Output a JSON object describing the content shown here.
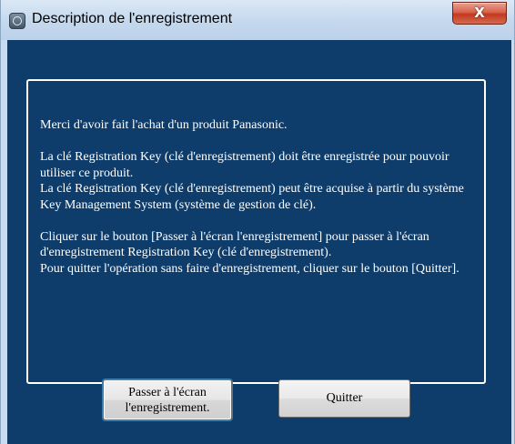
{
  "window": {
    "title": "Description de l'enregistrement",
    "app_icon": "panasonic-app-icon",
    "close_symbol": "X"
  },
  "message": {
    "paragraphs": [
      "Merci d'avoir fait l'achat d'un produit Panasonic.",
      "La clé Registration Key (clé d'enregistrement) doit être enregistrée pour pouvoir utiliser ce produit.",
      "La clé Registration Key (clé d'enregistrement) peut être acquise à partir du système Key Management System (système de gestion de clé).",
      "Cliquer sur le bouton [Passer à l'écran l'enregistrement] pour passer à l'écran d'enregistrement Registration Key (clé d'enregistrement).",
      "Pour quitter l'opération sans faire d'enregistrement, cliquer sur le bouton [Quitter]."
    ]
  },
  "buttons": {
    "register_line1": "Passer à l'écran",
    "register_line2": "l'enregistrement.",
    "quit": "Quitter"
  },
  "colors": {
    "content_background": "#0e3d6b",
    "text": "#ffffff",
    "titlebar": "#c4d8ed",
    "close_button": "#c2381e"
  }
}
